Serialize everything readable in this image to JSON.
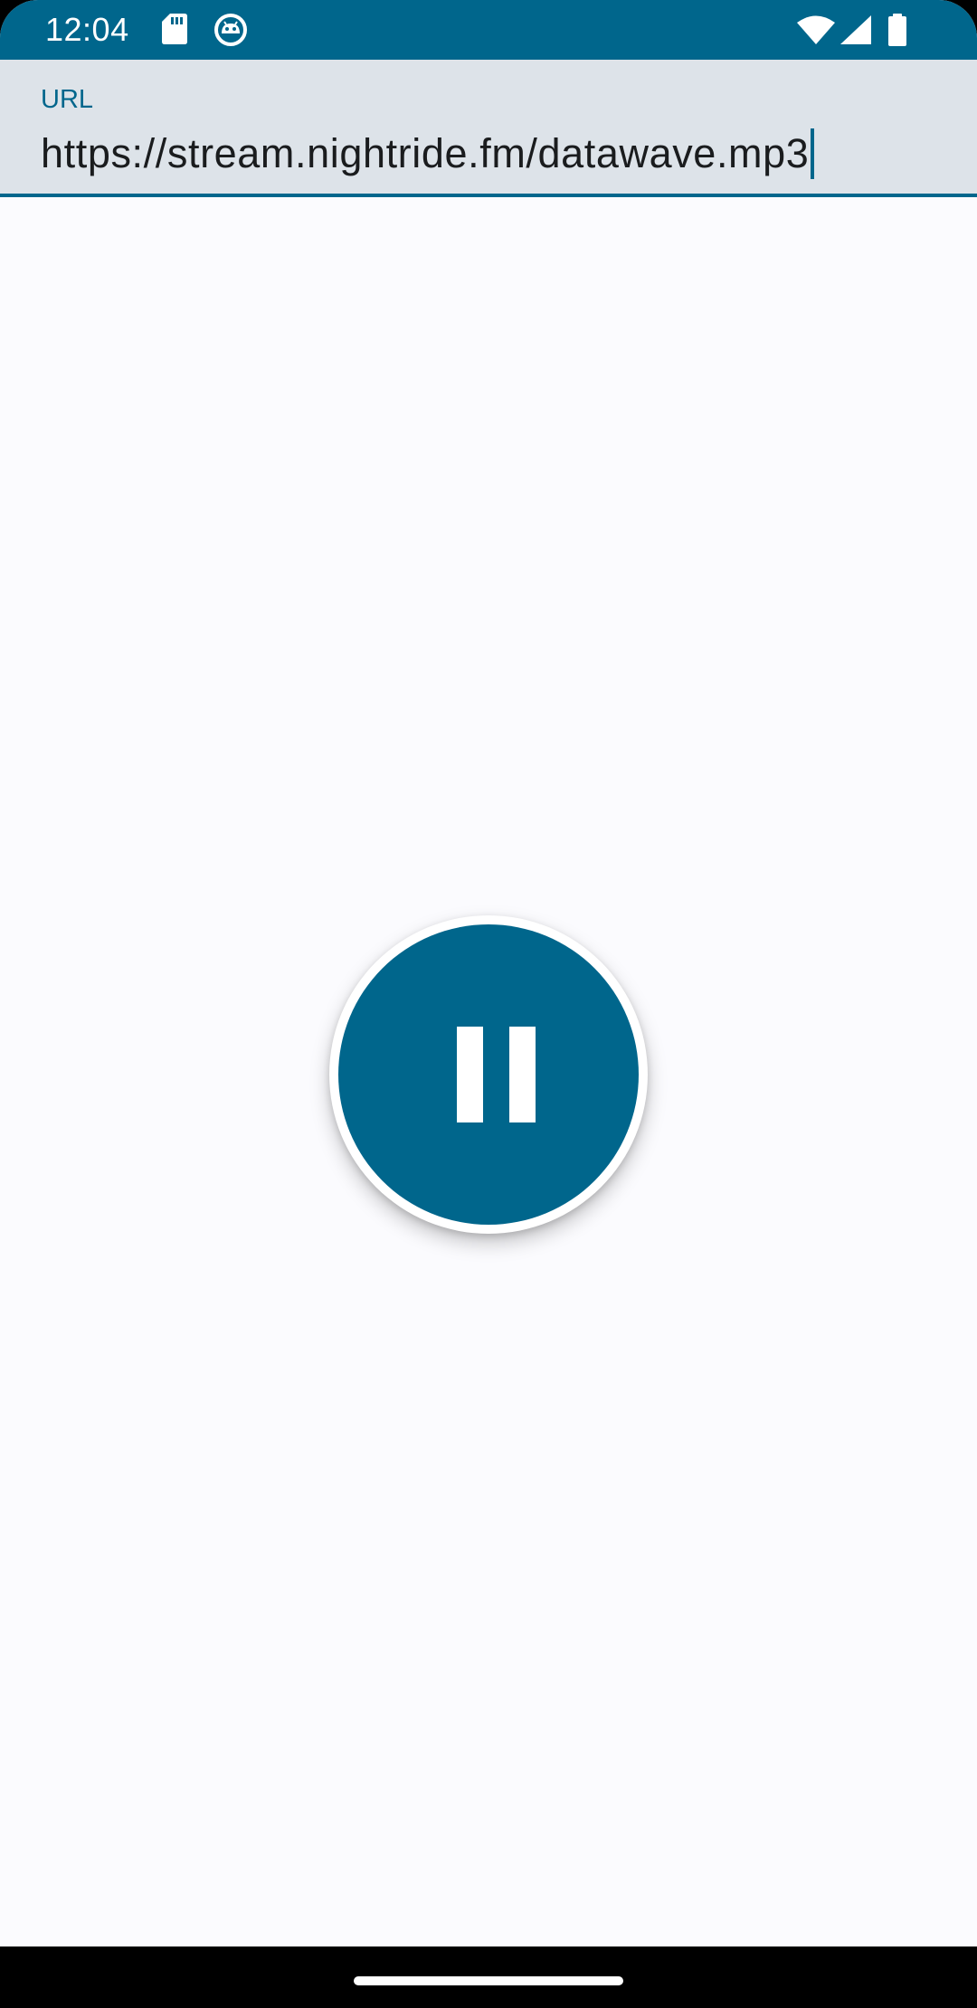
{
  "status_bar": {
    "time": "12:04",
    "left_icons": [
      "sd-card-icon",
      "android-debug-icon"
    ],
    "right_icons": [
      "wifi-icon",
      "cellular-signal-icon",
      "battery-icon"
    ],
    "background_color": "#00668c"
  },
  "url_field": {
    "label": "URL",
    "value": "https://stream.nightride.fm/datawave.mp3",
    "focused": true
  },
  "player": {
    "button_state": "playing",
    "button_icon": "pause-icon",
    "accent_color": "#00668c"
  },
  "navigation": {
    "type": "gesture-handle"
  }
}
